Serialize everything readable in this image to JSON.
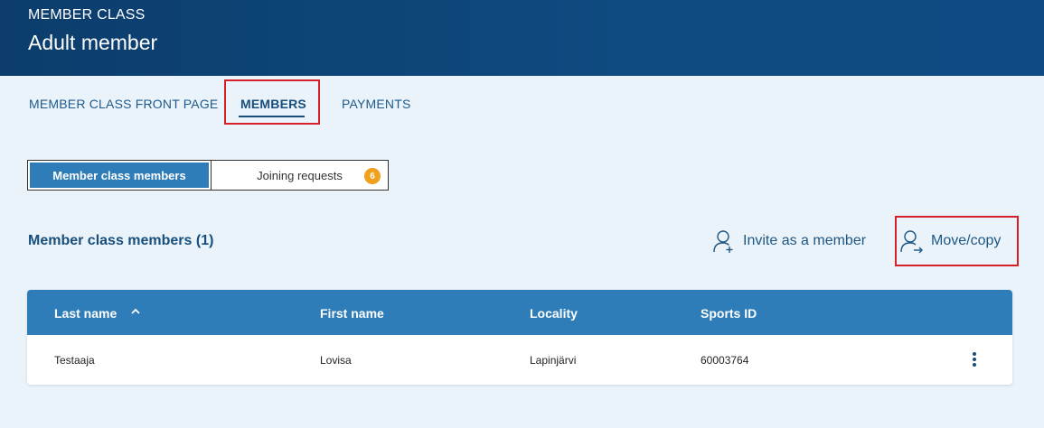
{
  "header": {
    "eyebrow": "MEMBER CLASS",
    "title": "Adult member"
  },
  "nav": {
    "tabs": [
      {
        "label": "MEMBER CLASS FRONT PAGE",
        "active": false
      },
      {
        "label": "MEMBERS",
        "active": true
      },
      {
        "label": "PAYMENTS",
        "active": false
      }
    ]
  },
  "segmented": {
    "active_label": "Member class members",
    "inactive_label": "Joining requests",
    "badge_count": "6"
  },
  "section": {
    "title": "Member class members (1)",
    "invite_label": "Invite as a member",
    "move_label": "Move/copy"
  },
  "table": {
    "columns": [
      "Last name",
      "First name",
      "Locality",
      "Sports ID"
    ],
    "sort": {
      "column": "Last name",
      "direction": "ascending"
    },
    "rows": [
      {
        "last_name": "Testaaja",
        "first_name": "Lovisa",
        "locality": "Lapinjärvi",
        "sports_id": "60003764"
      }
    ]
  },
  "colors": {
    "header_bg": "#0f4a80",
    "accent": "#2f7db8",
    "badge": "#f0a01b",
    "highlight": "#d61f26",
    "page_bg": "#eaf3f9"
  }
}
